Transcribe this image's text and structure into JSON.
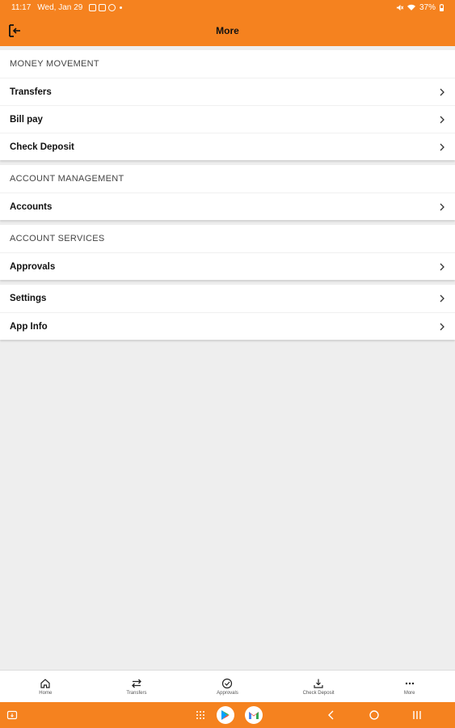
{
  "status_bar": {
    "time": "11:17",
    "date": "Wed, Jan 29",
    "battery": "37%"
  },
  "app_bar": {
    "title": "More"
  },
  "sections": [
    {
      "header": "MONEY MOVEMENT",
      "items": [
        {
          "label": "Transfers"
        },
        {
          "label": "Bill pay"
        },
        {
          "label": "Check Deposit"
        }
      ]
    },
    {
      "header": "ACCOUNT MANAGEMENT",
      "items": [
        {
          "label": "Accounts"
        }
      ]
    },
    {
      "header": "ACCOUNT SERVICES",
      "items": [
        {
          "label": "Approvals"
        }
      ]
    },
    {
      "header": "",
      "items": [
        {
          "label": "Settings"
        },
        {
          "label": "App Info"
        }
      ]
    }
  ],
  "tab_bar": {
    "tabs": [
      {
        "label": "Home",
        "icon": "home-icon"
      },
      {
        "label": "Transfers",
        "icon": "transfer-icon"
      },
      {
        "label": "Approvals",
        "icon": "check-circle-icon"
      },
      {
        "label": "Check Deposit",
        "icon": "download-icon"
      },
      {
        "label": "More",
        "icon": "more-icon"
      }
    ]
  },
  "colors": {
    "brand_orange": "#f5821f",
    "background": "#eeeeee"
  }
}
